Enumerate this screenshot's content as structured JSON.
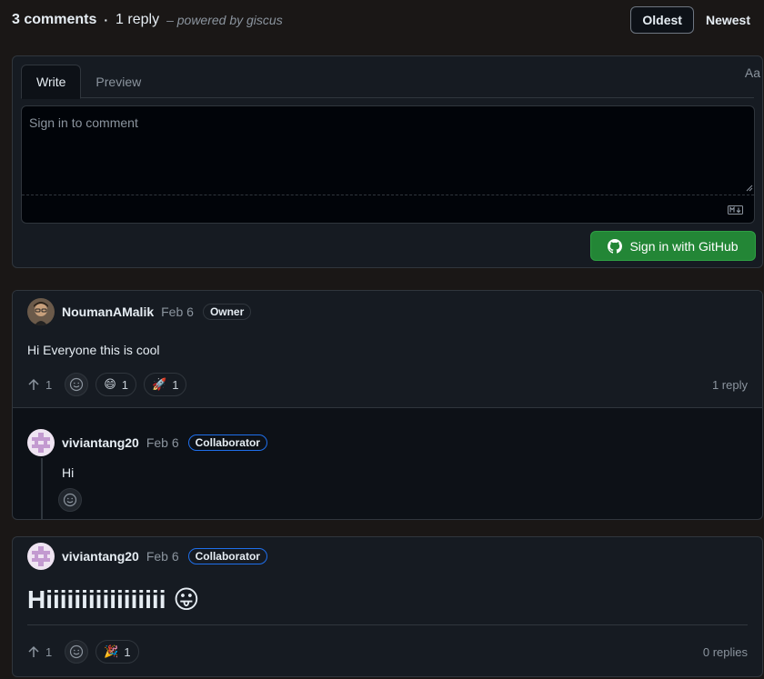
{
  "header": {
    "comments": "3 comments",
    "separator": "·",
    "replies": "1 reply",
    "powered": "– powered by giscus",
    "sort": {
      "oldest": "Oldest",
      "newest": "Newest"
    }
  },
  "editor": {
    "tab_write": "Write",
    "tab_preview": "Preview",
    "text_style": "Aa",
    "placeholder": "Sign in to comment",
    "signin_label": "Sign in with GitHub"
  },
  "comments": [
    {
      "author": "NoumanAMalik",
      "date": "Feb 6",
      "badge": "Owner",
      "body": "Hi Everyone this is cool",
      "upvotes": "1",
      "reactions": [
        {
          "emoji": "😄",
          "count": "1"
        },
        {
          "emoji": "🚀",
          "count": "1"
        }
      ],
      "reply_count": "1 reply",
      "reply": {
        "author": "viviantang20",
        "date": "Feb 6",
        "badge": "Collaborator",
        "body": "Hi"
      }
    },
    {
      "author": "viviantang20",
      "date": "Feb 6",
      "badge": "Collaborator",
      "body": "Hiiiiiiiiiiiiiiiii 😛",
      "upvotes": "1",
      "reactions": [
        {
          "emoji": "🎉",
          "count": "1"
        }
      ],
      "reply_count": "0 replies"
    }
  ],
  "colors": {
    "accent_green": "#238636",
    "collaborator_border": "#1f6feb"
  }
}
